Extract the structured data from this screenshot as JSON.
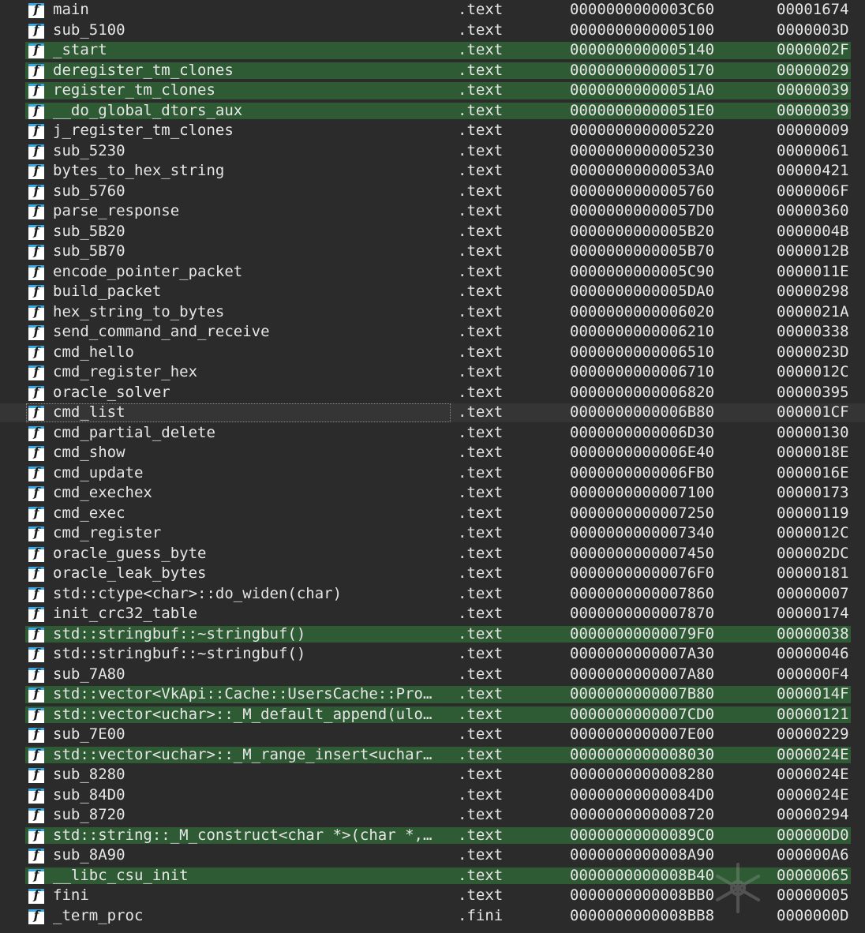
{
  "functions": [
    {
      "name": "main",
      "segment": ".text",
      "start": "0000000000003C60",
      "length": "00001674",
      "highlighted": false
    },
    {
      "name": "sub_5100",
      "segment": ".text",
      "start": "0000000000005100",
      "length": "0000003D",
      "highlighted": false
    },
    {
      "name": "_start",
      "segment": ".text",
      "start": "0000000000005140",
      "length": "0000002F",
      "highlighted": true
    },
    {
      "name": "deregister_tm_clones",
      "segment": ".text",
      "start": "0000000000005170",
      "length": "00000029",
      "highlighted": true
    },
    {
      "name": "register_tm_clones",
      "segment": ".text",
      "start": "00000000000051A0",
      "length": "00000039",
      "highlighted": true
    },
    {
      "name": "__do_global_dtors_aux",
      "segment": ".text",
      "start": "00000000000051E0",
      "length": "00000039",
      "highlighted": true
    },
    {
      "name": "j_register_tm_clones",
      "segment": ".text",
      "start": "0000000000005220",
      "length": "00000009",
      "highlighted": false
    },
    {
      "name": "sub_5230",
      "segment": ".text",
      "start": "0000000000005230",
      "length": "00000061",
      "highlighted": false
    },
    {
      "name": "bytes_to_hex_string",
      "segment": ".text",
      "start": "00000000000053A0",
      "length": "00000421",
      "highlighted": false
    },
    {
      "name": "sub_5760",
      "segment": ".text",
      "start": "0000000000005760",
      "length": "0000006F",
      "highlighted": false
    },
    {
      "name": "parse_response",
      "segment": ".text",
      "start": "00000000000057D0",
      "length": "00000360",
      "highlighted": false
    },
    {
      "name": "sub_5B20",
      "segment": ".text",
      "start": "0000000000005B20",
      "length": "0000004B",
      "highlighted": false
    },
    {
      "name": "sub_5B70",
      "segment": ".text",
      "start": "0000000000005B70",
      "length": "0000012B",
      "highlighted": false
    },
    {
      "name": "encode_pointer_packet",
      "segment": ".text",
      "start": "0000000000005C90",
      "length": "0000011E",
      "highlighted": false
    },
    {
      "name": "build_packet",
      "segment": ".text",
      "start": "0000000000005DA0",
      "length": "00000298",
      "highlighted": false
    },
    {
      "name": "hex_string_to_bytes",
      "segment": ".text",
      "start": "0000000000006020",
      "length": "0000021A",
      "highlighted": false
    },
    {
      "name": "send_command_and_receive",
      "segment": ".text",
      "start": "0000000000006210",
      "length": "00000338",
      "highlighted": false
    },
    {
      "name": "cmd_hello",
      "segment": ".text",
      "start": "0000000000006510",
      "length": "0000023D",
      "highlighted": false
    },
    {
      "name": "cmd_register_hex",
      "segment": ".text",
      "start": "0000000000006710",
      "length": "0000012C",
      "highlighted": false
    },
    {
      "name": "oracle_solver",
      "segment": ".text",
      "start": "0000000000006820",
      "length": "00000395",
      "highlighted": false
    },
    {
      "name": "cmd_list",
      "segment": ".text",
      "start": "0000000000006B80",
      "length": "000001CF",
      "highlighted": false,
      "selected": true
    },
    {
      "name": "cmd_partial_delete",
      "segment": ".text",
      "start": "0000000000006D30",
      "length": "00000130",
      "highlighted": false
    },
    {
      "name": "cmd_show",
      "segment": ".text",
      "start": "0000000000006E40",
      "length": "0000018E",
      "highlighted": false
    },
    {
      "name": "cmd_update",
      "segment": ".text",
      "start": "0000000000006FB0",
      "length": "0000016E",
      "highlighted": false
    },
    {
      "name": "cmd_exechex",
      "segment": ".text",
      "start": "0000000000007100",
      "length": "00000173",
      "highlighted": false
    },
    {
      "name": "cmd_exec",
      "segment": ".text",
      "start": "0000000000007250",
      "length": "00000119",
      "highlighted": false
    },
    {
      "name": "cmd_register",
      "segment": ".text",
      "start": "0000000000007340",
      "length": "0000012C",
      "highlighted": false
    },
    {
      "name": "oracle_guess_byte",
      "segment": ".text",
      "start": "0000000000007450",
      "length": "000002DC",
      "highlighted": false
    },
    {
      "name": "oracle_leak_bytes",
      "segment": ".text",
      "start": "00000000000076F0",
      "length": "00000181",
      "highlighted": false
    },
    {
      "name": "std::ctype<char>::do_widen(char)",
      "segment": ".text",
      "start": "0000000000007860",
      "length": "00000007",
      "highlighted": false
    },
    {
      "name": "init_crc32_table",
      "segment": ".text",
      "start": "0000000000007870",
      "length": "00000174",
      "highlighted": false
    },
    {
      "name": "std::stringbuf::~stringbuf()",
      "segment": ".text",
      "start": "00000000000079F0",
      "length": "00000038",
      "highlighted": true
    },
    {
      "name": "std::stringbuf::~stringbuf()",
      "segment": ".text",
      "start": "0000000000007A30",
      "length": "00000046",
      "highlighted": false
    },
    {
      "name": "sub_7A80",
      "segment": ".text",
      "start": "0000000000007A80",
      "length": "000000F4",
      "highlighted": false
    },
    {
      "name": "std::vector<VkApi::Cache::UsersCache::Pro…",
      "segment": ".text",
      "start": "0000000000007B80",
      "length": "0000014F",
      "highlighted": true
    },
    {
      "name": "std::vector<uchar>::_M_default_append(ulo…",
      "segment": ".text",
      "start": "0000000000007CD0",
      "length": "00000121",
      "highlighted": true
    },
    {
      "name": "sub_7E00",
      "segment": ".text",
      "start": "0000000000007E00",
      "length": "00000229",
      "highlighted": false
    },
    {
      "name": "std::vector<uchar>::_M_range_insert<uchar…",
      "segment": ".text",
      "start": "0000000000008030",
      "length": "0000024E",
      "highlighted": true
    },
    {
      "name": "sub_8280",
      "segment": ".text",
      "start": "0000000000008280",
      "length": "0000024E",
      "highlighted": false
    },
    {
      "name": "sub_84D0",
      "segment": ".text",
      "start": "00000000000084D0",
      "length": "0000024E",
      "highlighted": false
    },
    {
      "name": "sub_8720",
      "segment": ".text",
      "start": "0000000000008720",
      "length": "00000294",
      "highlighted": false
    },
    {
      "name": "std::string::_M_construct<char *>(char *,…",
      "segment": ".text",
      "start": "00000000000089C0",
      "length": "000000D0",
      "highlighted": true
    },
    {
      "name": "sub_8A90",
      "segment": ".text",
      "start": "0000000000008A90",
      "length": "000000A6",
      "highlighted": false
    },
    {
      "name": "__libc_csu_init",
      "segment": ".text",
      "start": "0000000000008B40",
      "length": "00000065",
      "highlighted": true
    },
    {
      "name": "fini",
      "segment": ".text",
      "start": "0000000000008BB0",
      "length": "00000005",
      "highlighted": false
    },
    {
      "name": "_term_proc",
      "segment": ".fini",
      "start": "0000000000008BB8",
      "length": "0000000D",
      "highlighted": false
    }
  ],
  "icons": {
    "function": "function-icon",
    "glyph": "f"
  },
  "colors": {
    "background": "#2b2b2b",
    "highlight": "#2e5a34",
    "icon_bar": "#3aa7e0"
  }
}
